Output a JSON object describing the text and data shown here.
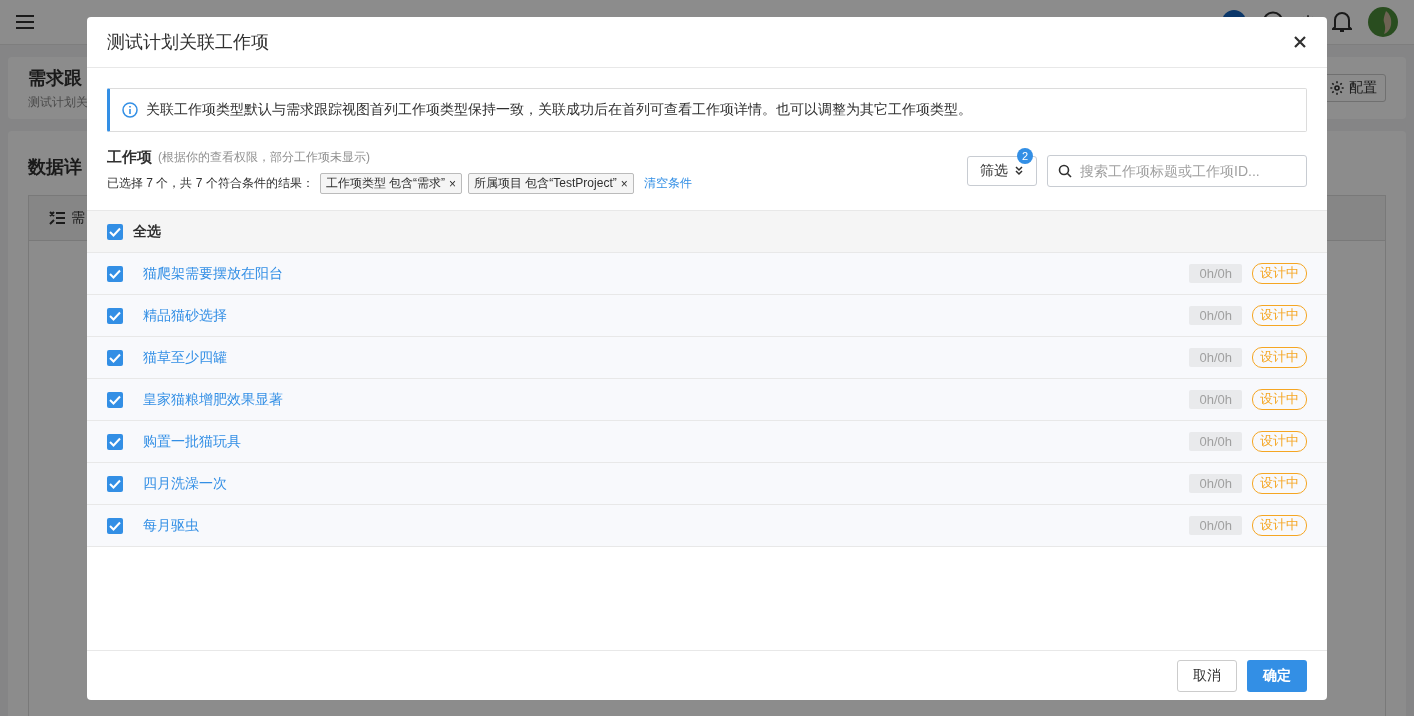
{
  "page": {
    "title": "需求跟",
    "subtitle": "测试计划关",
    "config_button": "配置",
    "section_title": "数据详",
    "table_column": "需"
  },
  "dialog": {
    "title": "测试计划关联工作项",
    "notice": "关联工作项类型默认与需求跟踪视图首列工作项类型保持一致，关联成功后在首列可查看工作项详情。也可以调整为其它工作项类型。",
    "section_title": "工作项",
    "hint": "(根据你的查看权限，部分工作项未显示)",
    "summary": "已选择 7 个，共 7 个符合条件的结果：",
    "filters": [
      {
        "label": "工作项类型 包含“需求”",
        "remove": "×"
      },
      {
        "label": "所属项目 包含“TestProject”",
        "remove": "×"
      }
    ],
    "clear": "清空条件",
    "filter_button": {
      "label": "筛选",
      "count": "2"
    },
    "search": {
      "placeholder": "搜索工作项标题或工作项ID..."
    },
    "select_all": {
      "label": "全选",
      "checked": true
    },
    "items": [
      {
        "title": "猫爬架需要摆放在阳台",
        "checked": true,
        "hours": "0h/0h",
        "status": "设计中"
      },
      {
        "title": "精品猫砂选择",
        "checked": true,
        "hours": "0h/0h",
        "status": "设计中"
      },
      {
        "title": "猫草至少四罐",
        "checked": true,
        "hours": "0h/0h",
        "status": "设计中"
      },
      {
        "title": "皇家猫粮增肥效果显著",
        "checked": true,
        "hours": "0h/0h",
        "status": "设计中"
      },
      {
        "title": "购置一批猫玩具",
        "checked": true,
        "hours": "0h/0h",
        "status": "设计中"
      },
      {
        "title": "四月洗澡一次",
        "checked": true,
        "hours": "0h/0h",
        "status": "设计中"
      },
      {
        "title": "每月驱虫",
        "checked": true,
        "hours": "0h/0h",
        "status": "设计中"
      }
    ],
    "buttons": {
      "cancel": "取消",
      "confirm": "确定"
    }
  }
}
